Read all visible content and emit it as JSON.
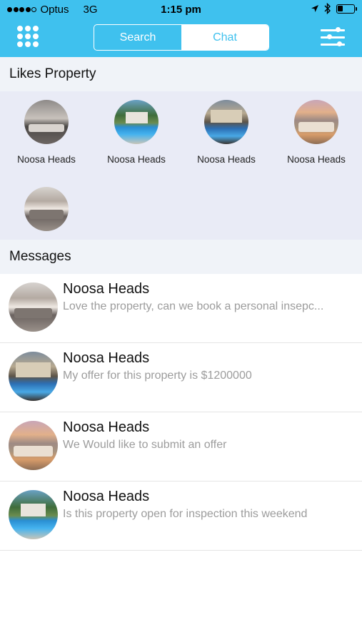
{
  "status_bar": {
    "carrier": "Optus",
    "network": "3G",
    "time": "1:15 pm",
    "signal_bars": 4,
    "signal_total": 5,
    "battery_level": 0.35,
    "icons": [
      "location-arrow-icon",
      "bluetooth-icon",
      "battery-icon"
    ]
  },
  "nav": {
    "menu_icon": "grid-menu-icon",
    "tabs": [
      {
        "label": "Search",
        "selected": false
      },
      {
        "label": "Chat",
        "selected": true
      }
    ],
    "filter_icon": "filter-sliders-icon"
  },
  "likes": {
    "title": "Likes Property",
    "items": [
      {
        "label": "Noosa Heads",
        "image": "interior-photo"
      },
      {
        "label": "Noosa Heads",
        "image": "pool-photo"
      },
      {
        "label": "Noosa Heads",
        "image": "house-pool-photo"
      },
      {
        "label": "Noosa Heads",
        "image": "sunset-living-photo"
      },
      {
        "label": "",
        "image": "living-room-photo"
      }
    ]
  },
  "messages": {
    "title": "Messages",
    "items": [
      {
        "title": "Noosa Heads",
        "preview": "Love the property, can we book a personal insepc...",
        "image": "living-room-photo"
      },
      {
        "title": "Noosa Heads",
        "preview": "My offer for this property is $1200000",
        "image": "house-pool-photo"
      },
      {
        "title": "Noosa Heads",
        "preview": "We Would like to submit an offer",
        "image": "sunset-living-photo"
      },
      {
        "title": "Noosa Heads",
        "preview": "Is this property open for inspection this weekend",
        "image": "pool-photo"
      }
    ]
  },
  "colors": {
    "header_bg": "#3fc1ee",
    "section_bg": "#f0f3f8",
    "likes_bg": "#e9ebf6",
    "preview_text": "#9c9c9c"
  }
}
